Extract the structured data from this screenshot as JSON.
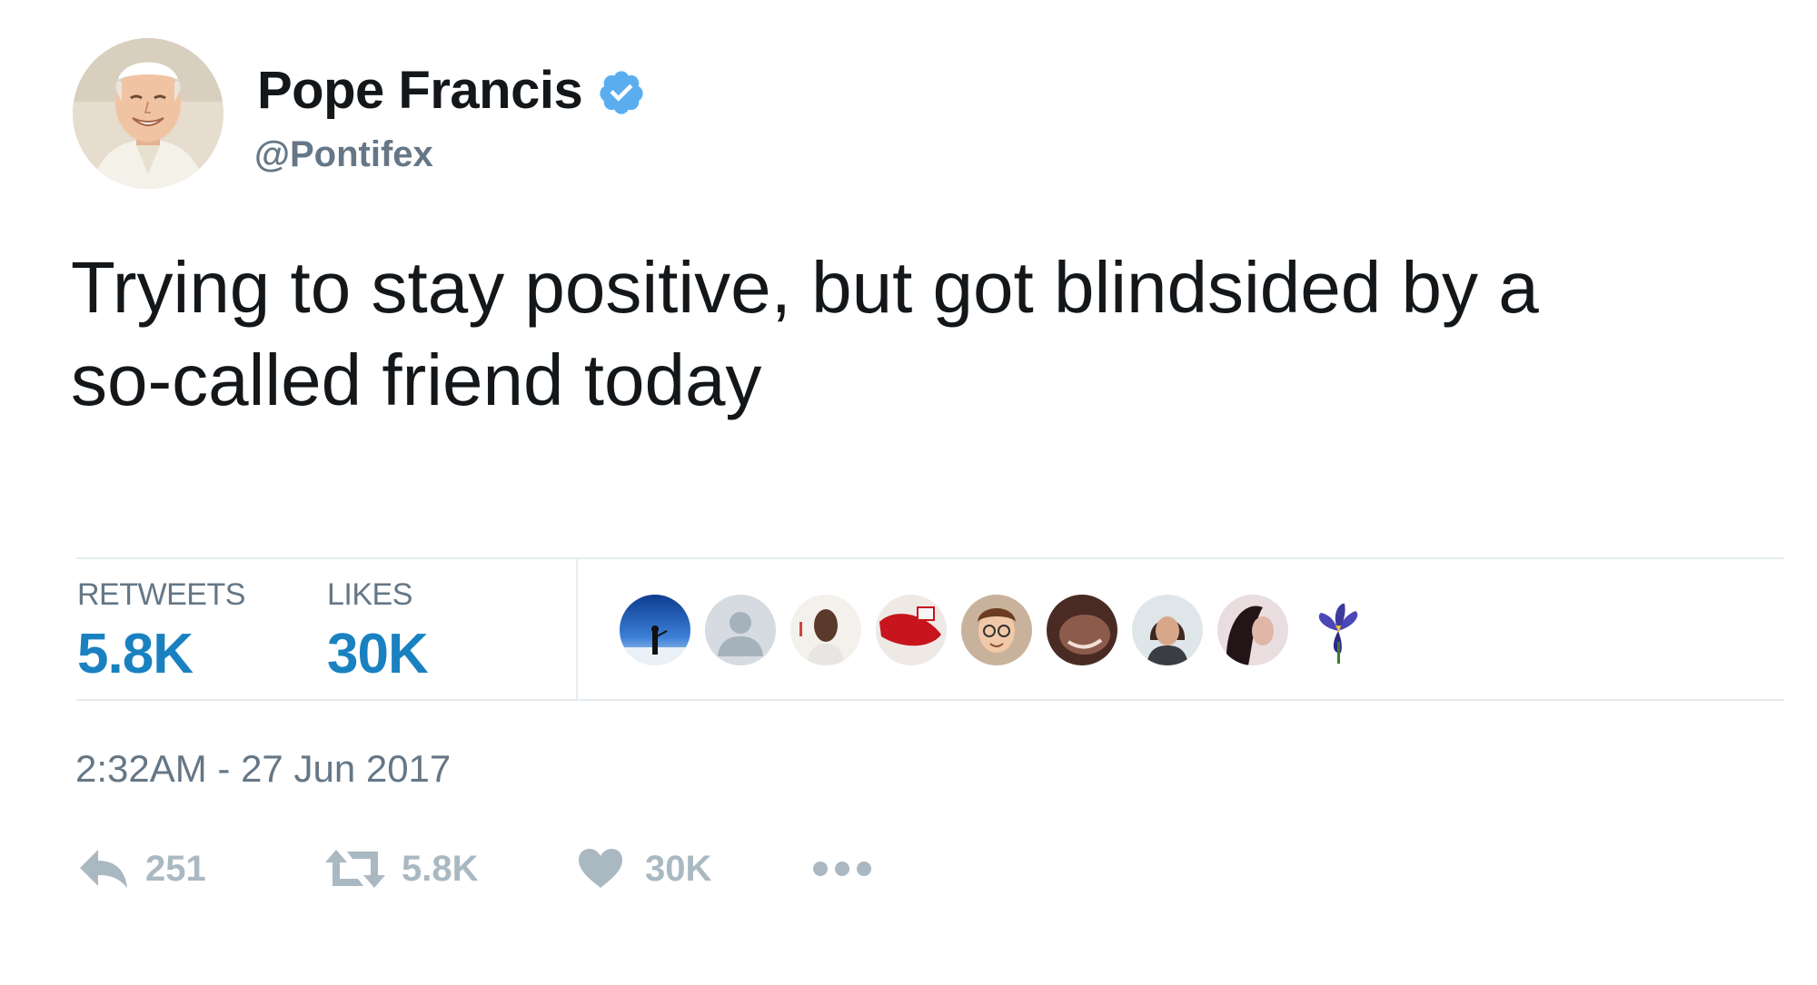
{
  "user": {
    "display_name": "Pope Francis",
    "handle": "@Pontifex",
    "avatar_icon": "person-photo-avatar",
    "verified_icon": "verified-badge-icon",
    "verified_color": "#5AAEF0"
  },
  "tweet": {
    "text_line1": "Trying to stay positive, but got blindsided by a",
    "text_line2": "so-called friend today",
    "timestamp": "2:32AM - 27 Jun 2017"
  },
  "stats": {
    "retweets_label": "RETWEETS",
    "retweets_value": "5.8K",
    "likes_label": "LIKES",
    "likes_value": "30K",
    "value_color": "#1A81C1"
  },
  "likers": [
    {
      "icon": "liker-avatar-1"
    },
    {
      "icon": "liker-avatar-2"
    },
    {
      "icon": "liker-avatar-3"
    },
    {
      "icon": "liker-avatar-4"
    },
    {
      "icon": "liker-avatar-5"
    },
    {
      "icon": "liker-avatar-6"
    },
    {
      "icon": "liker-avatar-7"
    },
    {
      "icon": "liker-avatar-8"
    },
    {
      "icon": "liker-avatar-9"
    }
  ],
  "actions": {
    "reply_count": "251",
    "retweet_count": "5.8K",
    "like_count": "30K",
    "icon_color": "#AAB8C2"
  }
}
